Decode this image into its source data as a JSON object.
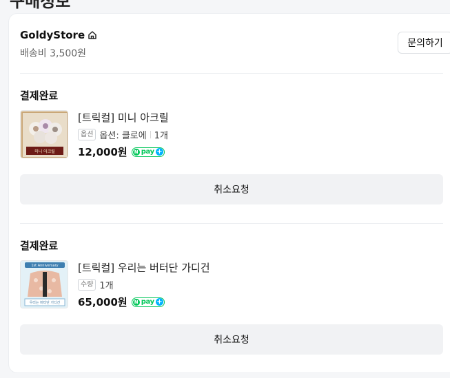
{
  "page_heading_partial": "구매정보",
  "store": {
    "name": "GoldyStore",
    "shipping": "배송비 3,500원",
    "inquiry_label": "문의하기"
  },
  "orders": [
    {
      "status": "결제완료",
      "product_name": "[트릭컬] 미니 아크릴",
      "option_tag": "옵션",
      "option_text": "옵션: 클로에",
      "quantity": "1개",
      "price": "12,000원",
      "pay_badge": "pay",
      "thumb_caption": "미니 아크릴",
      "cancel_label": "취소요청"
    },
    {
      "status": "결제완료",
      "product_name": "[트릭컬] 우리는 버터단 가디건",
      "option_tag": "수량",
      "quantity": "1개",
      "price": "65,000원",
      "pay_badge": "pay",
      "thumb_caption": "우리는 버터단 가디건",
      "thumb_banner": "1st Anniversary",
      "cancel_label": "취소요청"
    }
  ],
  "colors": {
    "npay_green": "#03c75a",
    "npay_plus_blue": "#00b3ff",
    "button_gray": "#f1f2f4"
  }
}
